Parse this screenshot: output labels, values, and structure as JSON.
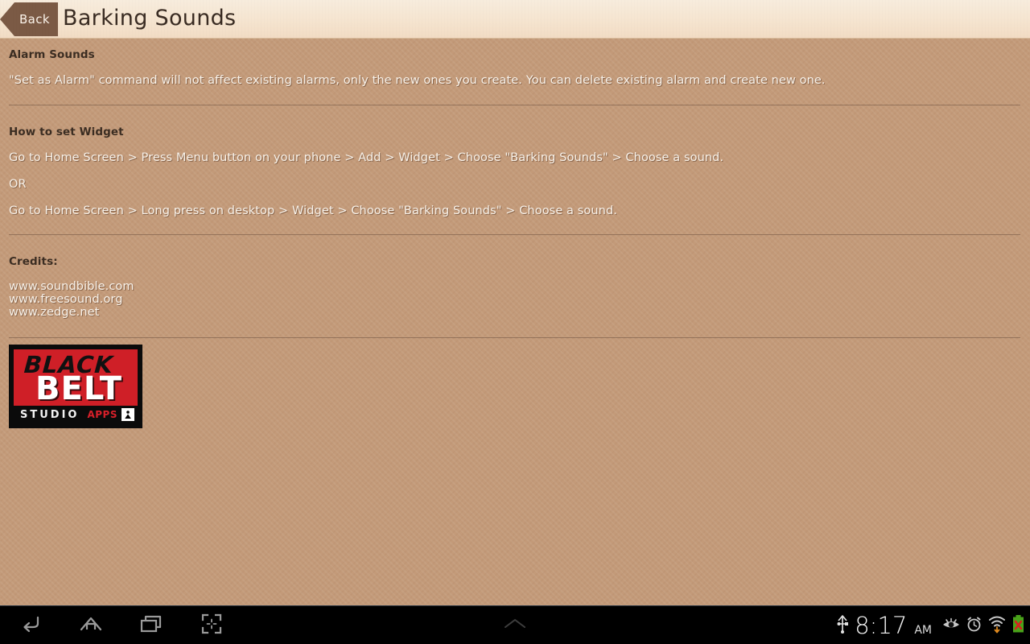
{
  "header": {
    "back_label": "Back",
    "title": "Barking Sounds"
  },
  "content": {
    "alarm_heading": "Alarm Sounds",
    "alarm_body": "\"Set as Alarm\" command will not affect existing alarms, only the new ones you create. You can delete existing alarm and create new one.",
    "widget_heading": "How to set Widget",
    "widget_line1": "Go to Home Screen > Press Menu button on your phone > Add > Widget > Choose \"Barking Sounds\" > Choose a sound.",
    "widget_or": "OR",
    "widget_line2": "Go to Home Screen > Long press on desktop > Widget > Choose \"Barking Sounds\" > Choose a sound.",
    "credits_heading": "Credits:",
    "credits": [
      "www.soundbible.com",
      "www.freesound.org",
      "www.zedge.net"
    ]
  },
  "logo": {
    "line1": "BLACK",
    "line2": "BELT",
    "line3": "STUDIO",
    "line4": "APPS",
    "background_color": "#cf1f27",
    "border_color": "#0b0b0b"
  },
  "system_bar": {
    "nav": [
      {
        "name": "back-nav-icon"
      },
      {
        "name": "home-nav-icon"
      },
      {
        "name": "recent-apps-nav-icon"
      },
      {
        "name": "screenshot-nav-icon"
      }
    ],
    "center_icon": "chevron-up-icon",
    "status": {
      "usb_icon": "usb-icon",
      "time": "8:17",
      "meridiem": "AM",
      "eye_icon": "eye-icon",
      "alarm_icon": "alarm-clock-icon",
      "wifi_icon": "wifi-icon",
      "battery_icon": "battery-error-icon"
    }
  },
  "theme": {
    "page_background": "#c39a79",
    "header_background": "#f6e6d2",
    "heading_color": "#3b2d22",
    "body_text_color": "#f7f1e9",
    "back_button_color": "#7b5a45"
  }
}
